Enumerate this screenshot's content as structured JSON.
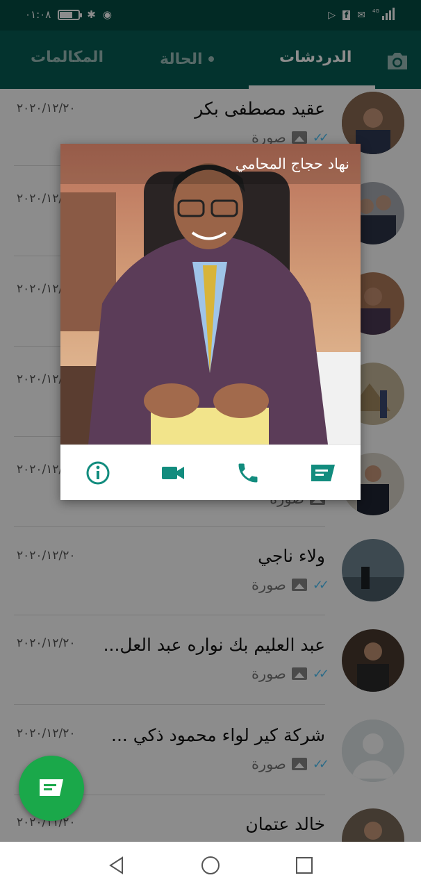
{
  "status_bar": {
    "time": "٠١:٠٨",
    "signal_label": "4G"
  },
  "tabs": [
    {
      "label": "الدردشات",
      "active": true
    },
    {
      "label": "الحالة",
      "active": false
    },
    {
      "label": "المكالمات",
      "active": false
    }
  ],
  "chats": [
    {
      "name": "عقيد مصطفى بكر",
      "preview": "صورة",
      "date": "٢٠٢٠/١٢/٢٠"
    },
    {
      "name": "",
      "preview": "",
      "date": "٢٠٢٠/١٢/"
    },
    {
      "name": "",
      "preview": "",
      "date": "٢٠٢٠/١٢/"
    },
    {
      "name": "",
      "preview": "",
      "date": "٢٠٢٠/١٢/"
    },
    {
      "name": "",
      "preview": "صورة",
      "date": "٢٠٢٠/١٢/"
    },
    {
      "name": "ولاء ناجي",
      "preview": "صورة",
      "date": "٢٠٢٠/١٢/٢٠"
    },
    {
      "name": "عبد العليم بك نواره عبد العل...",
      "preview": "صورة",
      "date": "٢٠٢٠/١٢/٢٠"
    },
    {
      "name": "شركة كير لواء محمود ذكي ...",
      "preview": "صورة",
      "date": "٢٠٢٠/١٢/٢٠"
    },
    {
      "name": "خالد عتمان",
      "preview": "",
      "date": "٢٠٢٠/١١/٢٠"
    }
  ],
  "popup": {
    "contact_name": "نهاد حجاج المحامي",
    "actions": [
      "message-icon",
      "call-icon",
      "video-call-icon",
      "info-icon"
    ]
  },
  "colors": {
    "header": "#075e54",
    "accent": "#128c7e",
    "fab": "#1aa84a"
  }
}
